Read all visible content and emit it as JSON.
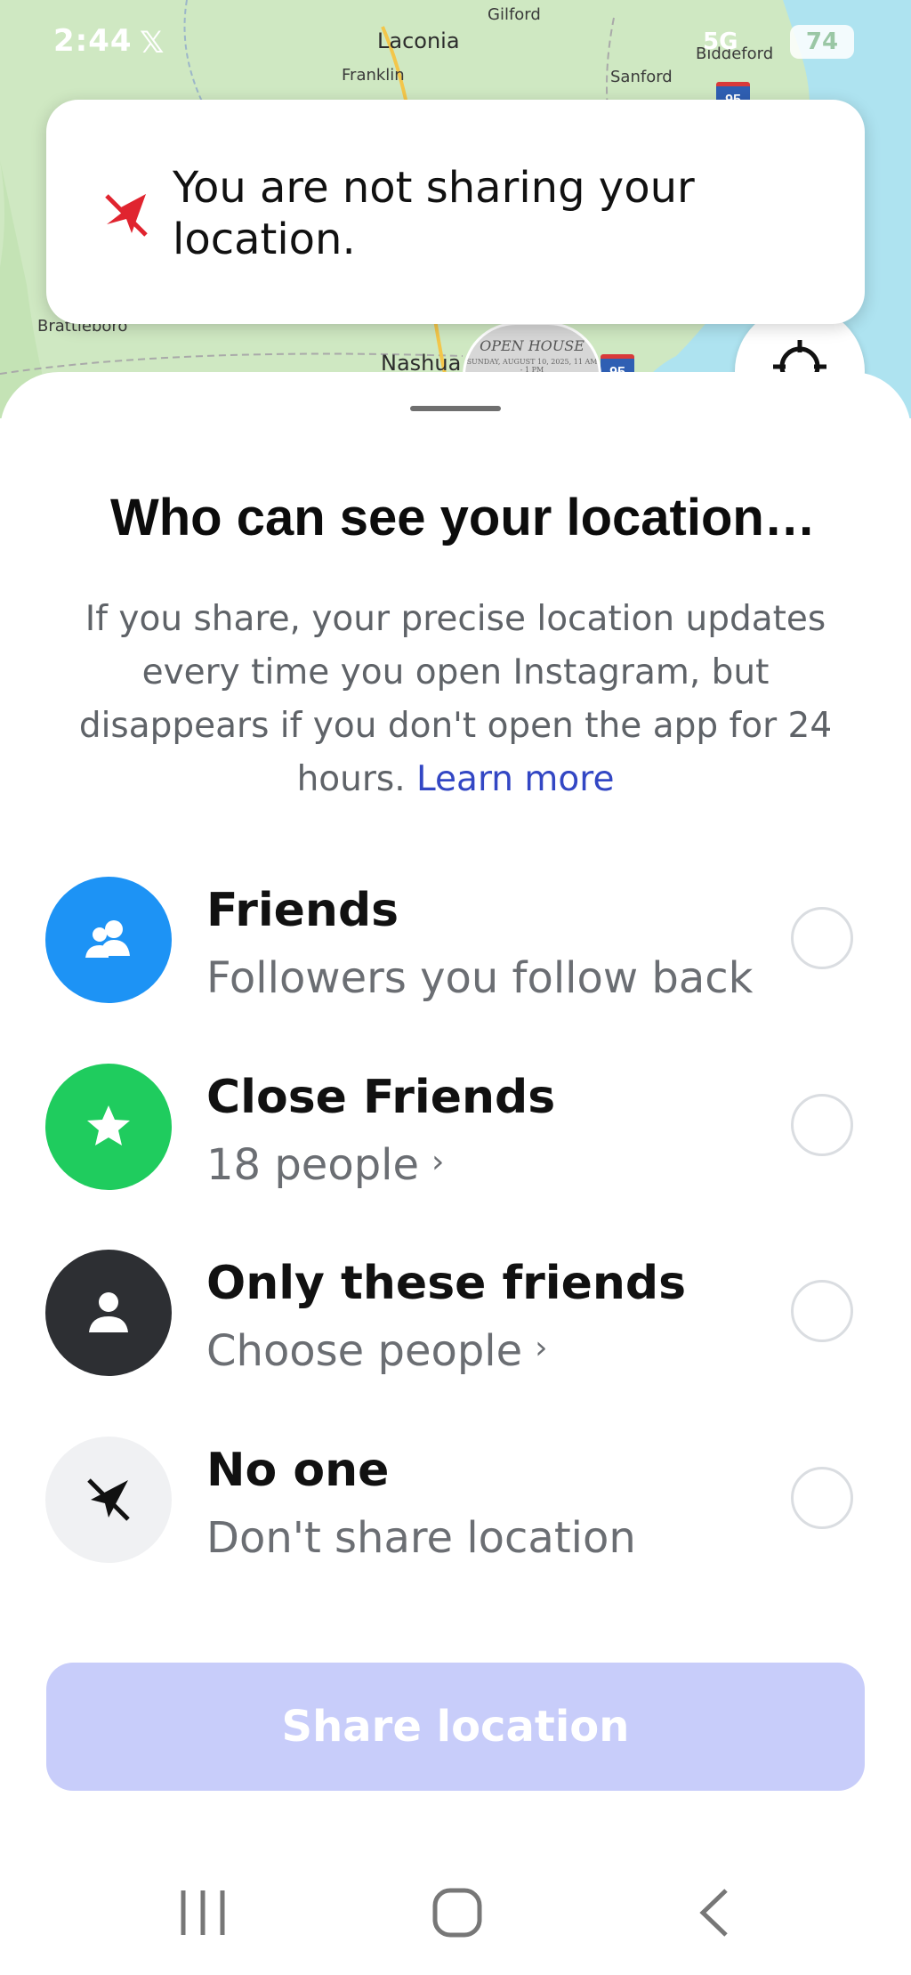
{
  "status_bar": {
    "time": "2:44",
    "x_logo": "𝕏",
    "network": "5G",
    "battery": "74"
  },
  "map": {
    "labels": [
      "Gilford",
      "Laconia",
      "Franklin",
      "Sanford",
      "Biddeford",
      "Brattleboro",
      "Nashua"
    ],
    "open_house": {
      "title": "OPEN HOUSE",
      "details": "SUNDAY, AUGUST 10, 2025, 11 AM - 1 PM"
    },
    "highway": "95"
  },
  "toast": {
    "message": "You are not sharing your location."
  },
  "sheet": {
    "title": "Who can see your location…",
    "description": "If you share, your precise location updates every time you open Instagram, but disappears if you don't open the app for 24 hours.",
    "learn_more": "Learn more",
    "options": [
      {
        "label": "Friends",
        "sub": "Followers you follow back",
        "color": "#1d93f5",
        "icon": "people-icon"
      },
      {
        "label": "Close Friends",
        "sub": "18 people",
        "color": "#1fcc5e",
        "icon": "star-icon",
        "chevron": "›"
      },
      {
        "label": "Only these friends",
        "sub": "Choose people",
        "color": "#2d2f33",
        "icon": "person-icon",
        "chevron": "›"
      },
      {
        "label": "No one",
        "sub": "Don't share location",
        "color": "#f0f1f3",
        "icon": "location-off-icon"
      }
    ],
    "share_button": "Share location"
  },
  "colors": {
    "accent": "#3347c4",
    "toast_icon": "#e0242f",
    "button_disabled": "#c8cdfa"
  }
}
